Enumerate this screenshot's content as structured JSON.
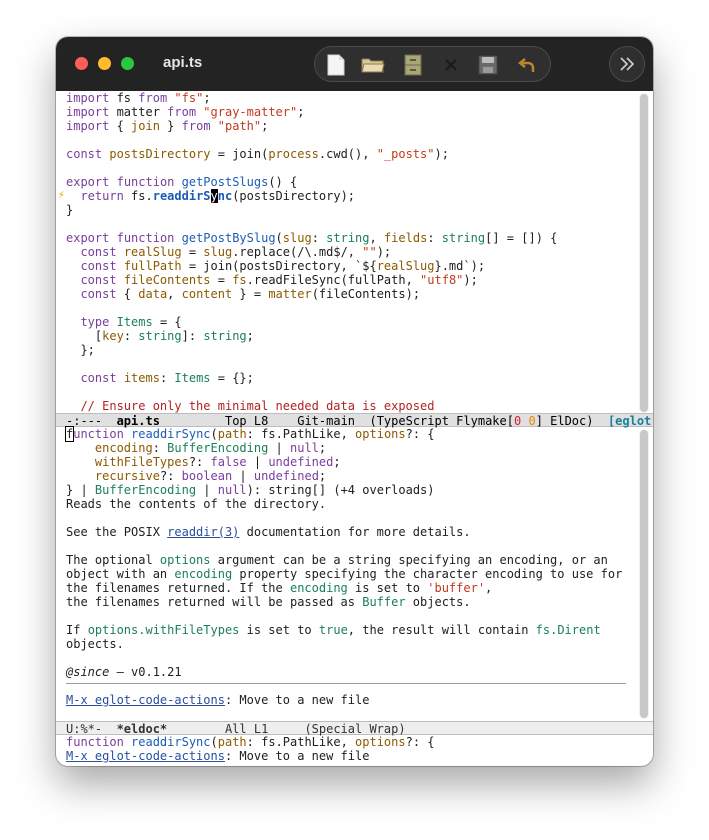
{
  "window": {
    "title": "api.ts"
  },
  "toolbar": {
    "buttons": [
      {
        "name": "new-file-icon"
      },
      {
        "name": "open-folder-icon"
      },
      {
        "name": "file-cabinet-icon"
      },
      {
        "name": "close-icon"
      },
      {
        "name": "save-icon"
      },
      {
        "name": "undo-icon"
      }
    ],
    "more_icon": "chevron-double-right-icon"
  },
  "code": {
    "l1": [
      "import",
      " fs ",
      "from",
      " ",
      "\"fs\"",
      ";"
    ],
    "l2": [
      "import",
      " matter ",
      "from",
      " ",
      "\"gray-matter\"",
      ";"
    ],
    "l3": [
      "import",
      " { ",
      "join",
      " } ",
      "from",
      " ",
      "\"path\"",
      ";"
    ],
    "l5": [
      "const",
      " ",
      "postsDirectory",
      " = join(",
      "process",
      ".cwd(), ",
      "\"_posts\"",
      ");"
    ],
    "l7": [
      "export",
      " ",
      "function",
      " ",
      "getPostSlugs",
      "() {"
    ],
    "l8": [
      "  ",
      "return",
      " fs.",
      "readdirS",
      "y",
      "nc",
      "(postsDirectory);"
    ],
    "l9": "}",
    "l12": [
      "export",
      " ",
      "function",
      " ",
      "getPostBySlug",
      "(",
      "slug",
      ": ",
      "string",
      ", ",
      "fields",
      ": ",
      "string",
      "[] = []) {"
    ],
    "l13": [
      "  ",
      "const",
      " ",
      "realSlug",
      " = ",
      "slug",
      ".replace(/\\.md$/, ",
      "\"\"",
      ");"
    ],
    "l14": [
      "  ",
      "const",
      " ",
      "fullPath",
      " = join(postsDirectory, `${",
      "realSlug",
      "}.md`);"
    ],
    "l15": [
      "  ",
      "const",
      " ",
      "fileContents",
      " = ",
      "fs",
      ".readFileSync(fullPath, ",
      "\"utf8\"",
      ");"
    ],
    "l16": [
      "  ",
      "const",
      " { ",
      "data",
      ", ",
      "content",
      " } = ",
      "matter",
      "(fileContents);"
    ],
    "l18": [
      "  ",
      "type",
      " ",
      "Items",
      " = {"
    ],
    "l19": [
      "    [",
      "key",
      ": ",
      "string",
      "]: ",
      "string",
      ";"
    ],
    "l20": "  };",
    "l22": [
      "  ",
      "const",
      " ",
      "items",
      ": ",
      "Items",
      " = {};"
    ],
    "l24": "  // Ensure only the minimal needed data is exposed"
  },
  "modeline1": {
    "status": "-:---",
    "buffer": "api.ts",
    "position": "Top L8",
    "vc": "Git-main",
    "mode_pre": "(TypeScript Flymake[",
    "err": "0",
    "warn": "0",
    "mode_post": "] ElDoc)",
    "eglot": "[eglot:re"
  },
  "doc": {
    "d1": [
      "f",
      "unction",
      " ",
      "readdirSync",
      "(",
      "path",
      ": fs.PathLike, ",
      "options",
      "?: {"
    ],
    "d2": [
      "    ",
      "encoding",
      ": ",
      "BufferEncoding",
      " | ",
      "null",
      ";"
    ],
    "d3": [
      "    ",
      "withFileTypes",
      "?: ",
      "false",
      " | ",
      "undefined",
      ";"
    ],
    "d4": [
      "    ",
      "recursive",
      "?: ",
      "boolean",
      " | ",
      "undefined",
      ";"
    ],
    "d5": [
      "} | ",
      "BufferEncoding",
      " | ",
      "null",
      "): string[] (+4 overloads)"
    ],
    "d6": "Reads the contents of the directory.",
    "d8": [
      "See the POSIX ",
      "readdir(3)",
      " documentation for more details."
    ],
    "d10": [
      "The optional ",
      "options",
      " argument can be a string specifying an encoding, or an"
    ],
    "d11": [
      "object with an ",
      "encoding",
      " property specifying the character encoding to use for"
    ],
    "d12": [
      "the filenames returned. If the ",
      "encoding",
      " is set to ",
      "'buffer'",
      ","
    ],
    "d13": [
      "the filenames returned will be passed as ",
      "Buffer",
      " objects."
    ],
    "d15": [
      "If ",
      "options.withFileTypes",
      " is set to ",
      "true",
      ", the result will contain ",
      "fs.Dirent"
    ],
    "d16": "objects.",
    "d18": [
      "@since",
      " — v0.1.21"
    ],
    "d20": [
      "M-x eglot-code-actions",
      ": Move to a new file"
    ]
  },
  "modeline2": {
    "status": "U:%*-",
    "buffer": "*eldoc*",
    "position": "All L1",
    "mode": "(Special Wrap)"
  },
  "echo": {
    "e1": [
      "function",
      " ",
      "readdirSync",
      "(",
      "path",
      ": fs.PathLike, ",
      "options",
      "?: {"
    ],
    "e2": [
      "M-x eglot-code-actions",
      ": Move to a new file"
    ]
  }
}
